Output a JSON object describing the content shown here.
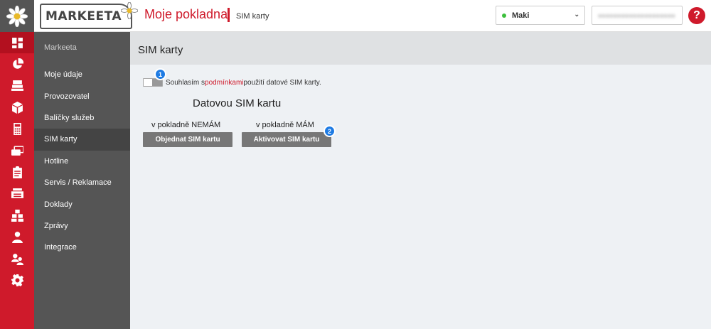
{
  "brand": {
    "text": "MARKEETA"
  },
  "header": {
    "app_title": "Moje pokladna",
    "breadcrumb": "SIM karty",
    "store": {
      "selected": "Maki",
      "status_color": "#3cbf3c"
    },
    "user": {
      "value": "●●●●●●●●●●●●●●●●●●●●"
    },
    "help_label": "?"
  },
  "rail": {
    "icons": [
      "dashboard-icon",
      "pie-chart-icon",
      "register-icon",
      "box-icon",
      "calculator-icon",
      "payment-icon",
      "clipboard-icon",
      "receipt-printer-icon",
      "packages-icon",
      "user-icon",
      "users-icon",
      "settings-icon"
    ],
    "active_index": 0
  },
  "sidebar": {
    "title": "Markeeta",
    "items": [
      {
        "label": "Moje údaje"
      },
      {
        "label": "Provozovatel"
      },
      {
        "label": "Balíčky služeb"
      },
      {
        "label": "SIM karty"
      },
      {
        "label": "Hotline"
      },
      {
        "label": "Servis / Reklamace"
      },
      {
        "label": "Doklady"
      },
      {
        "label": "Zprávy"
      },
      {
        "label": "Integrace"
      }
    ],
    "active_index": 3
  },
  "main": {
    "title": "SIM karty",
    "consent": {
      "before": "Souhlasím s ",
      "link": "podmínkami",
      "after": " použití datové SIM karty."
    },
    "section_title": "Datovou SIM kartu",
    "col_left": {
      "label": "v pokladně NEMÁM",
      "button": "Objednat SIM kartu"
    },
    "col_right": {
      "label": "v pokladně MÁM",
      "button": "Aktivovat SIM kartu"
    },
    "badges": [
      "1",
      "2"
    ]
  },
  "colors": {
    "accent": "#cf1a2b",
    "sidebar": "#555555",
    "badge": "#1e7be3",
    "button": "#777777"
  }
}
